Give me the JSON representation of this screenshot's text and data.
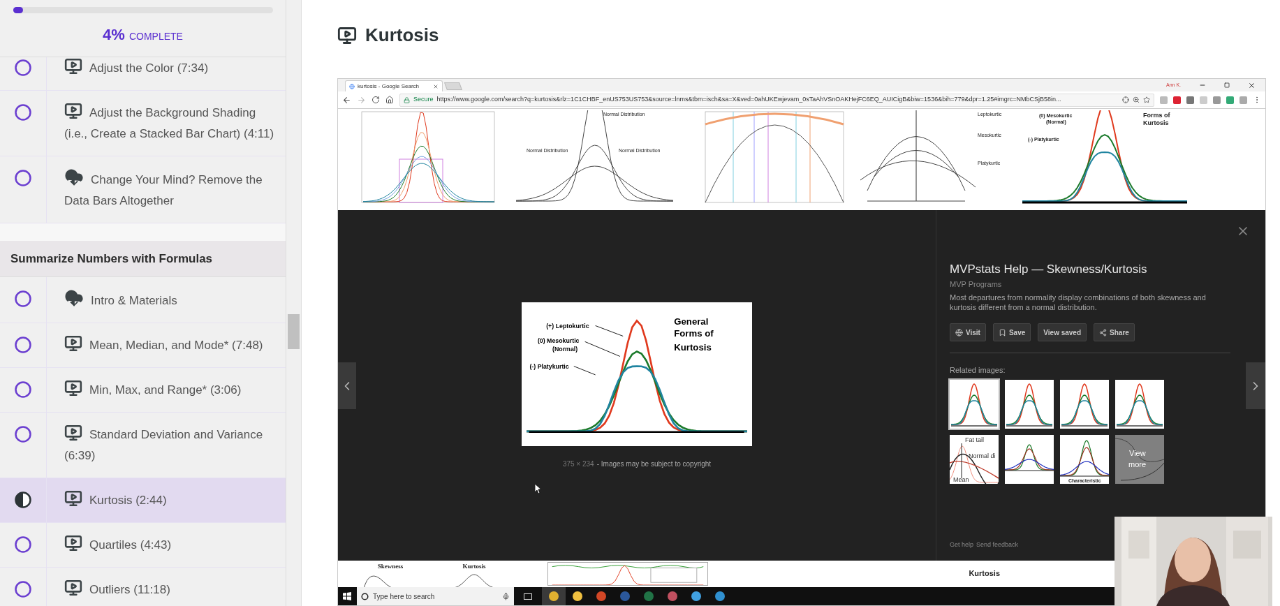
{
  "sidebar": {
    "progress": {
      "level": 0.04,
      "percent": "4%",
      "label": "COMPLETE"
    },
    "items": [
      {
        "kind": "video_lesson",
        "title": "Adjust the Color (7:34)",
        "started": false,
        "selected": false
      },
      {
        "kind": "video_lesson",
        "title": "Adjust the Background Shading (i.e., Create a Stacked Bar Chart) (4:11)",
        "started": false,
        "selected": false
      },
      {
        "kind": "download_lesson",
        "title": "Change Your Mind? Remove the Data Bars Altogether",
        "started": false,
        "selected": false
      },
      {
        "kind": "section",
        "title": "Summarize Numbers with Formulas"
      },
      {
        "kind": "download_lesson",
        "title": "Intro & Materials",
        "started": false,
        "selected": false
      },
      {
        "kind": "video_lesson",
        "title": "Mean, Median, and Mode* (7:48)",
        "started": false,
        "selected": false
      },
      {
        "kind": "video_lesson",
        "title": "Min, Max, and Range* (3:06)",
        "started": false,
        "selected": false
      },
      {
        "kind": "video_lesson",
        "title": "Standard Deviation and Variance (6:39)",
        "started": false,
        "selected": false
      },
      {
        "kind": "video_lesson",
        "title": "Kurtosis (2:44)",
        "started": true,
        "selected": true
      },
      {
        "kind": "video_lesson",
        "title": "Quartiles (4:43)",
        "started": false,
        "selected": false
      },
      {
        "kind": "video_lesson",
        "title": "Outliers (11:18)",
        "started": false,
        "selected": false
      }
    ]
  },
  "lesson_title": "Kurtosis",
  "browser": {
    "tab_title": "kurtosis - Google Search",
    "user": "Ann K.",
    "secure": "Secure",
    "url": "https://www.google.com/search?q=kurtosis&rlz=1C1CHBF_enUS753US753&source=lnms&tbm=isch&sa=X&ved=0ahUKEwjevam_0sTaAhVSnOAKHejFC6EQ_AUICigB&biw=1536&bih=779&dpr=1.25#imgrc=NMbCSjB58in..."
  },
  "results": [
    {
      "kind": "multi_curve"
    },
    {
      "kind": "normal_curves",
      "labels": [
        "Normal Distribution",
        "Normal Distribution",
        "Normal Distribution"
      ]
    },
    {
      "kind": "log_curves"
    },
    {
      "kind": "peak_family",
      "labels": [
        "Leptokurtic",
        "Mesokurtic",
        "Platykurtic"
      ]
    },
    {
      "kind": "kurtosis_forms",
      "labels": [
        "Forms of",
        "Kurtosis",
        "(0) Mesokurtic",
        "(Normal)",
        "(-) Platykurtic"
      ]
    }
  ],
  "viewer": {
    "image_labels": [
      "(+) Leptokurtic",
      "(0) Mesokurtic",
      "(Normal)",
      "(-) Platykurtic",
      "General",
      "Forms of",
      "Kurtosis"
    ],
    "dimensions": "375 × 234",
    "copyright": "- Images may be subject to copyright",
    "title": "MVPstats Help — Skewness/Kurtosis",
    "source": "MVP Programs",
    "description": "Most departures from normality display combinations of both skewness and kurtosis different from a normal distribution.",
    "actions": [
      {
        "kind": "visit",
        "label": "Visit"
      },
      {
        "kind": "save",
        "label": "Save"
      },
      {
        "kind": "plain",
        "label": "View saved"
      },
      {
        "kind": "share",
        "label": "Share"
      }
    ],
    "related_heading": "Related images:",
    "related": [
      {
        "kind": "three_curves",
        "selected": true
      },
      {
        "kind": "three_curves",
        "selected": false
      },
      {
        "kind": "three_curves",
        "selected": false
      },
      {
        "kind": "three_curves",
        "selected": false
      },
      {
        "kind": "fat_tail",
        "selected": false,
        "labels": [
          "Fat tail",
          "Normal di",
          "Mean"
        ]
      },
      {
        "kind": "blue_flat",
        "selected": false
      },
      {
        "kind": "characteristic",
        "selected": false,
        "labels": [
          "Characteristic"
        ]
      },
      {
        "kind": "view_more",
        "selected": false,
        "labels": [
          "View",
          "more"
        ]
      }
    ],
    "footer_links": [
      "Get help",
      "Send feedback"
    ]
  },
  "bottom_results": [
    {
      "kind": "skew",
      "label": "Skewness"
    },
    {
      "kind": "kurt",
      "label": "Kurtosis"
    },
    {
      "kind": "plot"
    },
    {
      "kind": "heading",
      "label": "Kurtosis"
    }
  ],
  "taskbar": {
    "search_placeholder": "Type here to search"
  }
}
